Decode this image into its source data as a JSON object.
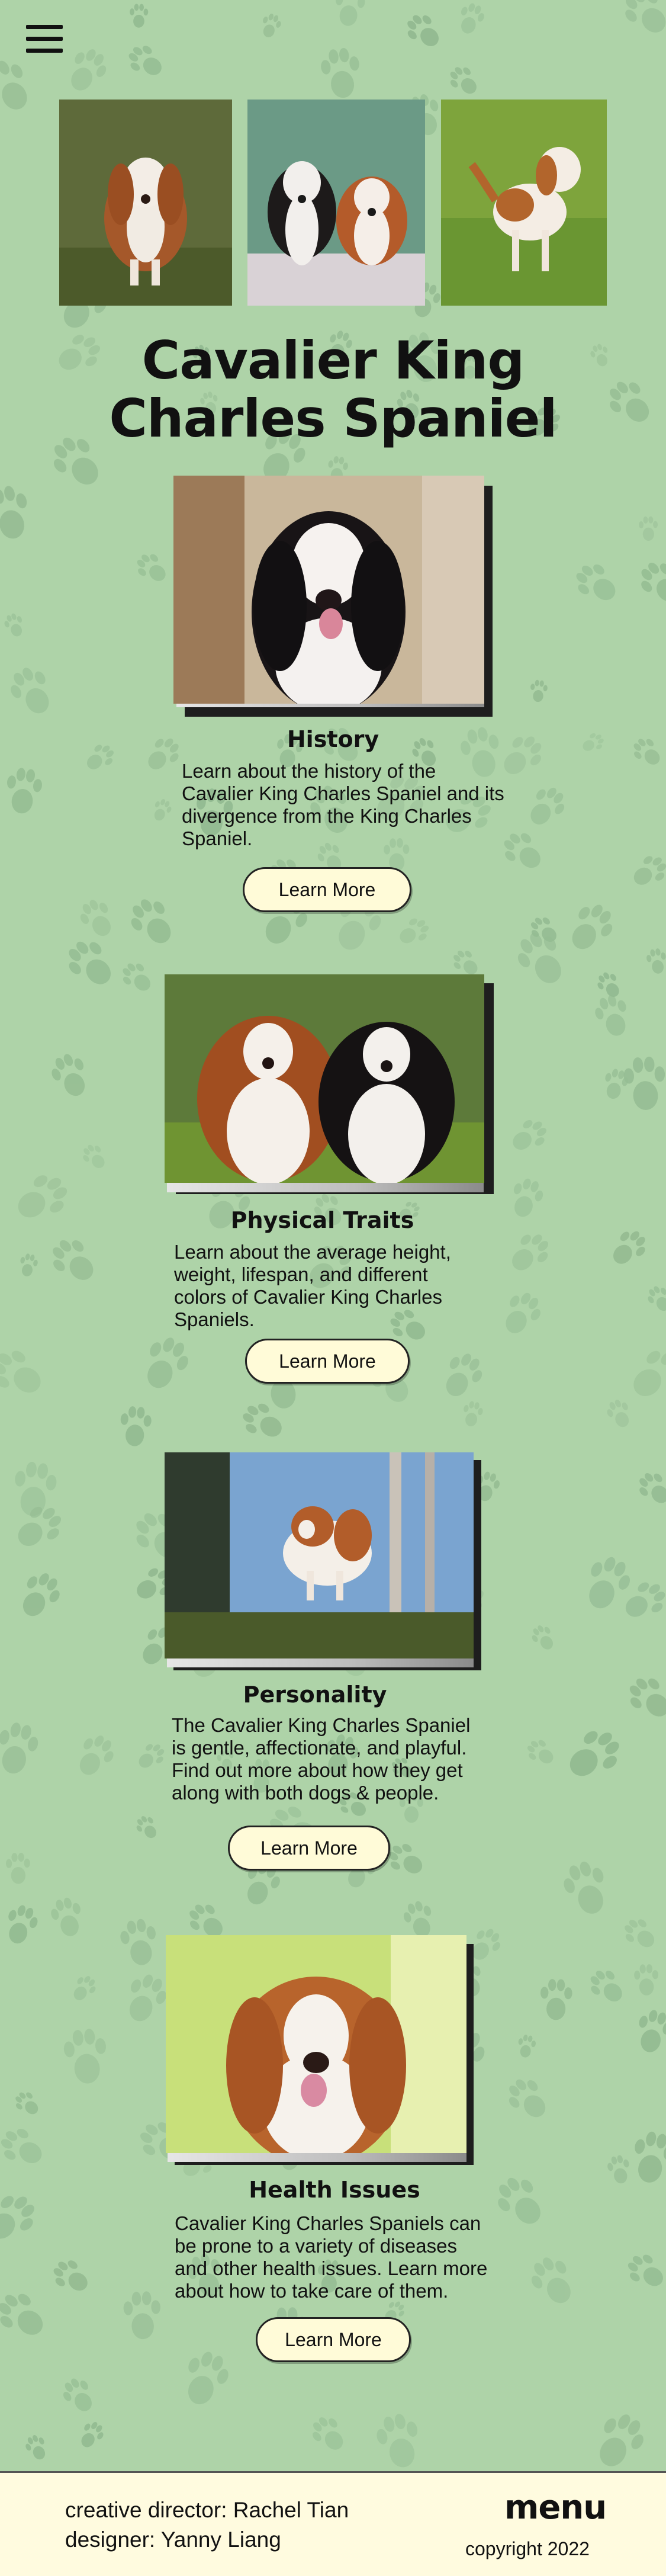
{
  "nav": {
    "menu_icon": "hamburger-menu-icon"
  },
  "hero": {
    "title_line1": "Cavalier King",
    "title_line2": "Charles Spaniel"
  },
  "sections": [
    {
      "title": "History",
      "text": "Learn about the history of the Cavalier King Charles Spaniel and its divergence from the King Charles Spaniel.",
      "button": "Learn More"
    },
    {
      "title": "Physical Traits",
      "text": "Learn about the average height, weight, lifespan, and different colors of Cavalier King Charles Spaniels.",
      "button": "Learn More"
    },
    {
      "title": "Personality",
      "text": "The Cavalier King Charles Spaniel is gentle, affectionate, and playful. Find out more about how they get along with both dogs & people.",
      "button": "Learn More"
    },
    {
      "title": "Health Issues",
      "text": "Cavalier King Charles Spaniels can be prone to a variety of diseases and other health issues. Learn more about how to take care of them.",
      "button": "Learn More"
    }
  ],
  "footer": {
    "credit1": "creative director: Rachel Tian",
    "credit2": "designer: Yanny Liang",
    "menu": "menu",
    "copyright": "copyright 2022"
  },
  "colors": {
    "background": "#aed3a8",
    "paw": "#7fa981",
    "button_fill": "#fffbd8",
    "footer_bg": "#fffbdf"
  }
}
